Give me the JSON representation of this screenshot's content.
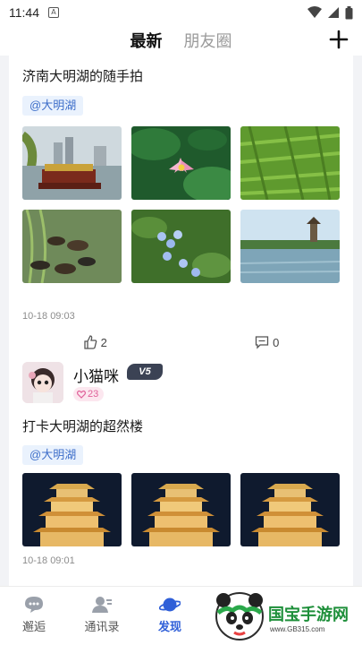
{
  "status_bar": {
    "time": "11:44"
  },
  "top_nav": {
    "tabs": [
      {
        "label": "最新",
        "active": true
      },
      {
        "label": "朋友圈",
        "active": false
      }
    ]
  },
  "posts": [
    {
      "text": "济南大明湖的随手拍",
      "topic": "@大明湖",
      "images": [
        "boat-icon",
        "lotus-icon",
        "grass-icon",
        "ducks-icon",
        "flowers-icon",
        "lake-pavilion-icon"
      ],
      "time": "10-18 09:03",
      "likes": "2",
      "comments": "0"
    },
    {
      "user": {
        "name": "小猫咪",
        "level": "V5",
        "fans": "23"
      },
      "text": "打卡大明湖的超然楼",
      "topic": "@大明湖",
      "images": [
        "tower-icon",
        "tower-icon",
        "tower-icon"
      ],
      "time": "10-18 09:01"
    }
  ],
  "bottom_nav": {
    "items": [
      {
        "label": "邂逅",
        "active": false
      },
      {
        "label": "通讯录",
        "active": false
      },
      {
        "label": "发现",
        "active": true
      }
    ]
  },
  "watermark": {
    "title": "国宝手游网",
    "url": "www.GB315.com"
  },
  "colors": {
    "accent": "#2f5fd8",
    "topic_bg": "#eaf2fd",
    "topic_text": "#3d6ec9"
  }
}
